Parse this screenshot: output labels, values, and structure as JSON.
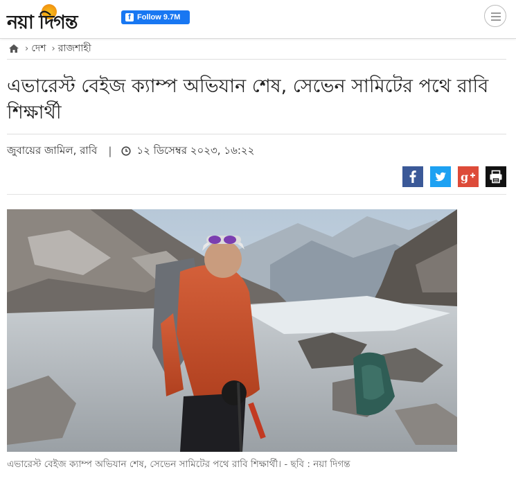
{
  "header": {
    "logo_text": "নয়া দিগন্ত",
    "fb_follow_label": "Follow 9.7M"
  },
  "breadcrumb": {
    "items": [
      "দেশ",
      "রাজশাহী"
    ]
  },
  "article": {
    "title": "এভারেস্ট বেইজ ক্যাম্প অভিযান শেষ, সেভেন সামিটের পথে রাবি শিক্ষার্থী",
    "author": "জুবায়ের জামিল, রাবি",
    "date": "১২ ডিসেম্বর ২০২৩, ১৬:২২",
    "caption": "এভারেস্ট বেইজ ক্যাম্প অভিযান শেষ, সেভেন সামিটের পথে রাবি শিক্ষার্থী। - ছবি : নয়া দিগন্ত"
  },
  "share": {
    "buttons": [
      "facebook",
      "twitter",
      "google-plus",
      "print"
    ]
  },
  "colors": {
    "facebook": "#3b5998",
    "twitter": "#1da1f2",
    "google_plus": "#dd4b39",
    "print": "#111111",
    "fb_follow": "#1877f2"
  },
  "icons": [
    "home-icon",
    "chevron-right-icon",
    "clock-icon",
    "menu-icon",
    "facebook-icon",
    "twitter-icon",
    "google-plus-icon",
    "print-icon"
  ]
}
